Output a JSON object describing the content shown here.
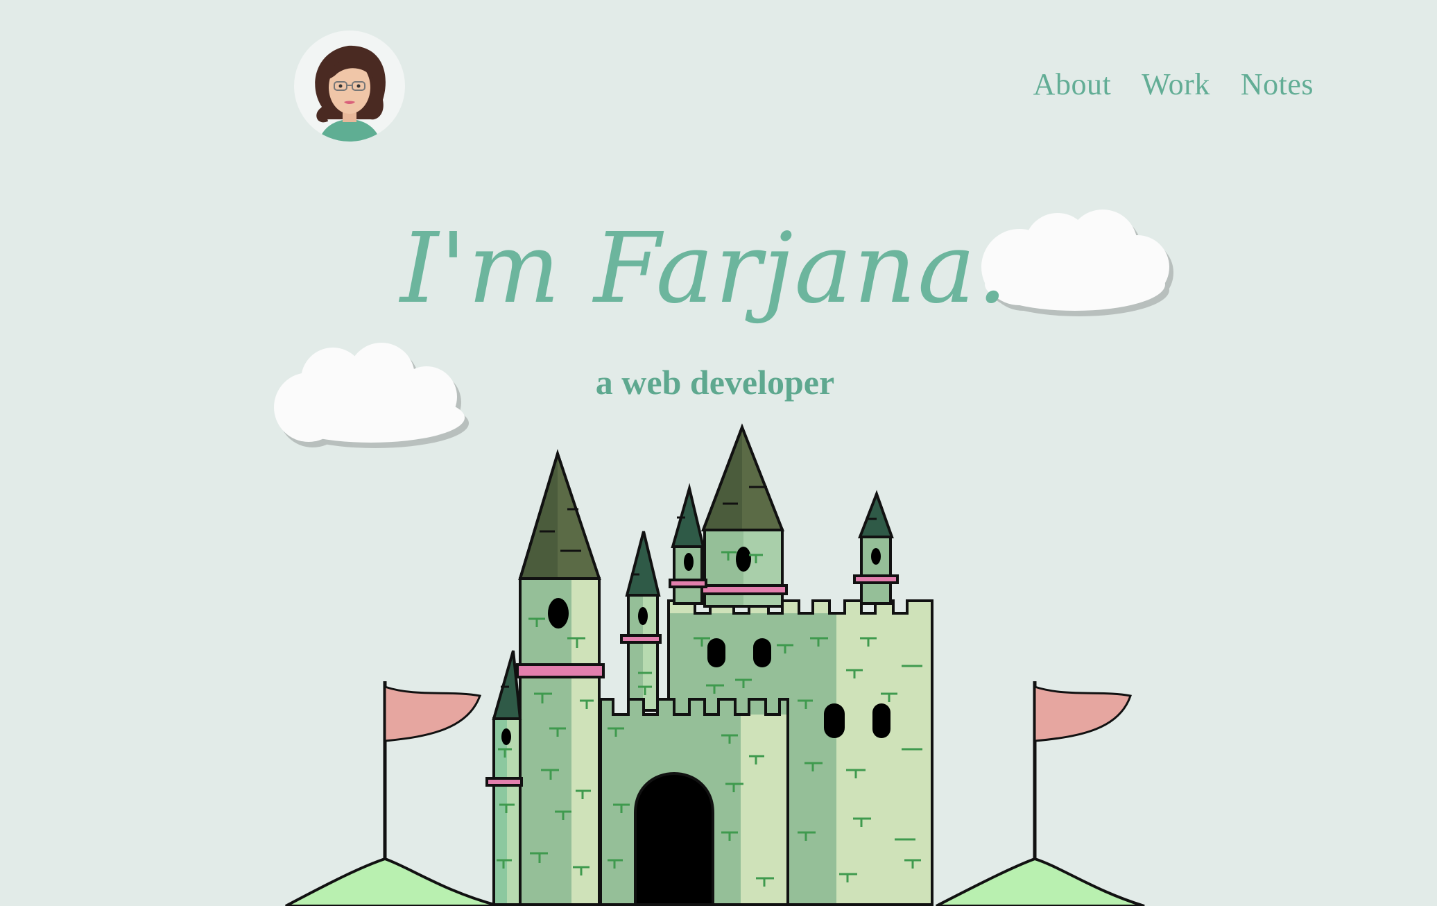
{
  "header": {
    "avatar_alt": "Farjana avatar",
    "nav": [
      {
        "label": "About"
      },
      {
        "label": "Work"
      },
      {
        "label": "Notes"
      }
    ]
  },
  "hero": {
    "title": "I'm Farjana.",
    "subtitle": "a web developer"
  },
  "colors": {
    "background": "#e2ebe8",
    "accent": "#62ad95",
    "flag": "#e6a6a0",
    "hill": "#b9f0b0",
    "castle_light": "#cfe2b9",
    "castle_mid": "#95bf98",
    "roof_dark": "#4b5c3c",
    "band_pink": "#e27fad"
  },
  "icons": [
    "avatar-illustration",
    "cloud-icon",
    "castle-illustration",
    "flag-icon"
  ]
}
